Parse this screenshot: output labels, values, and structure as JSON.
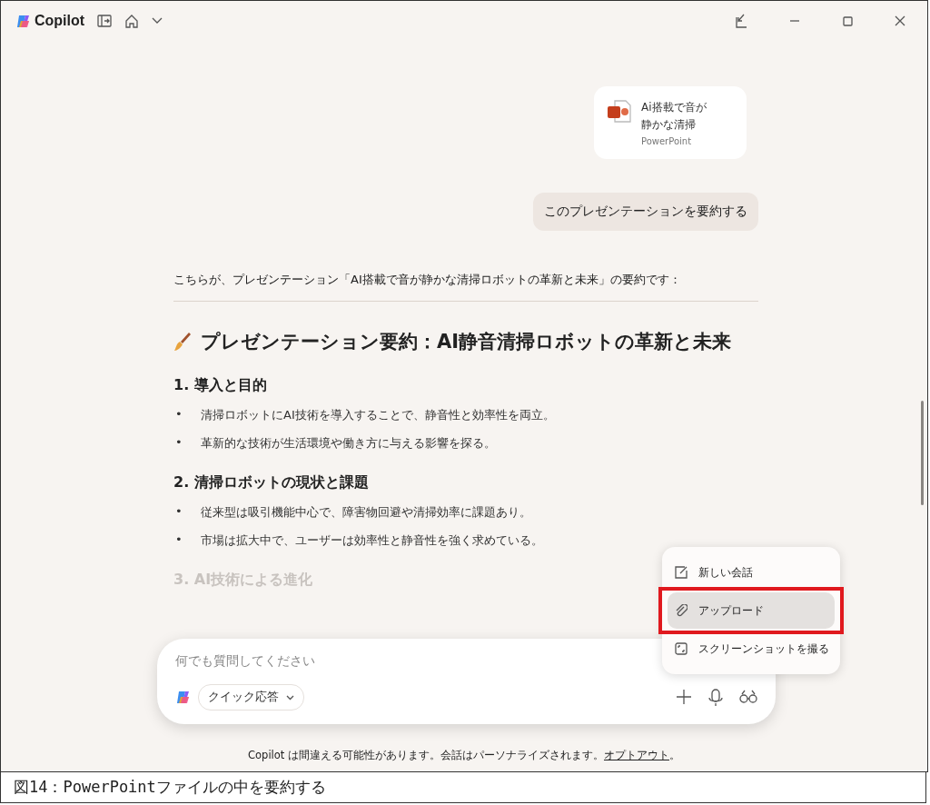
{
  "app": {
    "title": "Copilot"
  },
  "attachment": {
    "title_lines": [
      "Ai搭載で音が",
      "静かな清掃"
    ],
    "type": "PowerPoint"
  },
  "user_message": "このプレゼンテーションを要約する",
  "response": {
    "intro": "こちらが、プレゼンテーション「AI搭載で音が静かな清掃ロボットの革新と未来」の要約です：",
    "heading": "プレゼンテーション要約：AI静音清掃ロボットの革新と未来",
    "bullet": "•",
    "sections": [
      {
        "title": "1. 導入と目的",
        "faded": false,
        "bullets": [
          "清掃ロボットにAI技術を導入することで、静音性と効率性を両立。",
          "革新的な技術が生活環境や働き方に与える影響を探る。"
        ]
      },
      {
        "title": "2. 清掃ロボットの現状と課題",
        "faded": false,
        "bullets": [
          "従来型は吸引機能中心で、障害物回避や清掃効率に課題あり。",
          "市場は拡大中で、ユーザーは効率性と静音性を強く求めている。"
        ]
      },
      {
        "title": "3. AI技術による進化",
        "faded": true
      }
    ]
  },
  "composer": {
    "placeholder": "何でも質問してください",
    "mode": "クイック応答"
  },
  "menu": {
    "items": [
      {
        "kind": "new-chat",
        "label": "新しい会話",
        "selected": false,
        "outlined": false
      },
      {
        "kind": "upload",
        "label": "アップロード",
        "selected": true,
        "outlined": true
      },
      {
        "kind": "screenshot",
        "label": "スクリーンショットを撮る",
        "selected": false,
        "outlined": false
      }
    ]
  },
  "disclaimer": {
    "text": "Copilot は間違える可能性があります。会話はパーソナライズされます。",
    "link": "オプトアウト",
    "end": "。"
  },
  "caption": "図14：PowerPointファイルの中を要約する"
}
